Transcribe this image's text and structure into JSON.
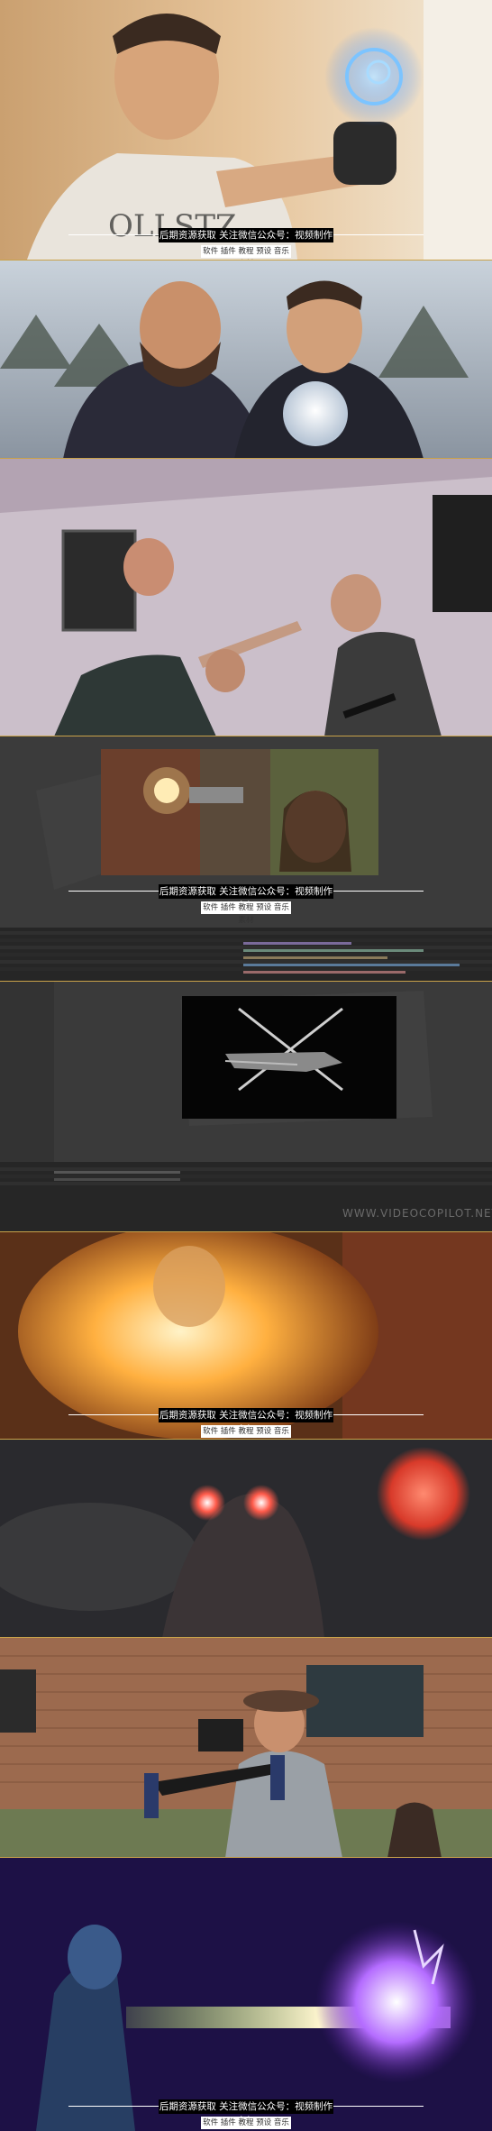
{
  "watermark": {
    "title": "后期资源获取 关注微信公众号：视频制作大叔",
    "subtitle": "软件 插件 教程 预设 音乐 素材"
  },
  "strips": [
    {
      "name": "hologram-gauntlet",
      "accent": "#5aa8ff"
    },
    {
      "name": "snow-crystal-ball",
      "accent": "#dfe8f2"
    },
    {
      "name": "office-head-hit",
      "accent": "#c9b9c7"
    },
    {
      "name": "ae-muzzle-flash",
      "accent": "#ffd98a"
    },
    {
      "name": "ae-helicopter",
      "accent": "#ffffff"
    },
    {
      "name": "fire-burst",
      "accent": "#ff9a2a"
    },
    {
      "name": "glowing-eyes",
      "accent": "#ff4a3a"
    },
    {
      "name": "camera-rig",
      "accent": "#8a5a3c"
    },
    {
      "name": "energy-beam",
      "accent": "#b46cff"
    }
  ],
  "ae_overlay_text": "WWW.VIDEOCOPILOT.NET"
}
